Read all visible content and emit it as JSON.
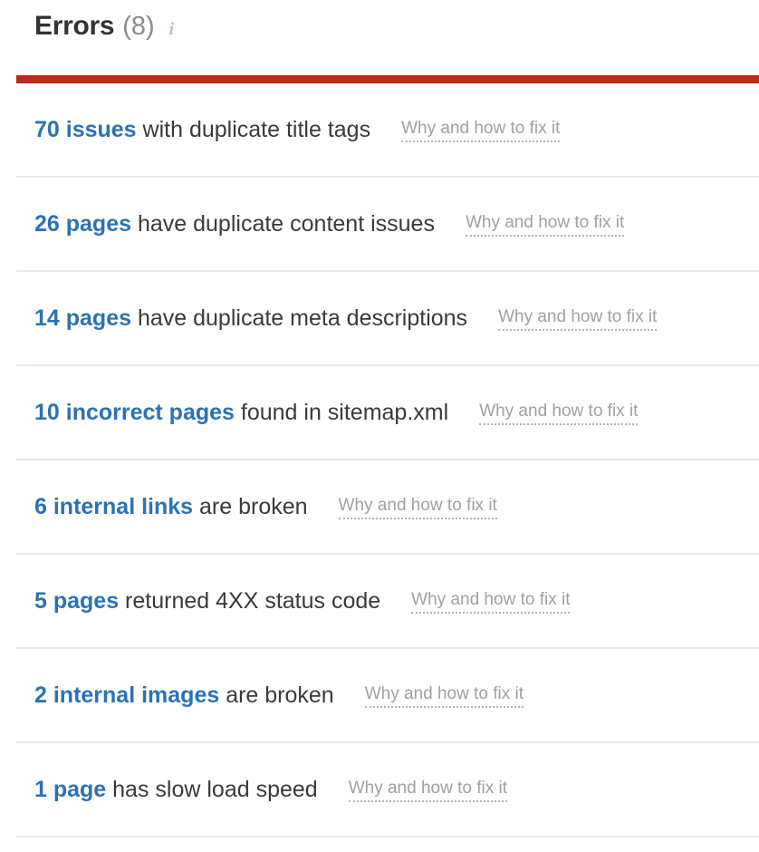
{
  "header": {
    "title": "Errors",
    "count": "(8)",
    "info_icon": "info-icon",
    "accent_color": "#bf2a1c",
    "title_color": "#333333",
    "count_color": "#8c8c8c"
  },
  "colors": {
    "severity_bar": "#bf2a1c",
    "link_blue": "#2b72b4",
    "fix_link_gray": "#a0a0a0",
    "separator": "#e4e9ef",
    "body_text": "#3a3a3a"
  },
  "issues": [
    {
      "count": "70 issues",
      "description": " with duplicate title tags",
      "fix_link": "Why and how to fix it"
    },
    {
      "count": "26 pages",
      "description": " have duplicate content issues",
      "fix_link": "Why and how to fix it"
    },
    {
      "count": "14 pages",
      "description": " have duplicate meta descriptions",
      "fix_link": "Why and how to fix it"
    },
    {
      "count": "10 incorrect pages",
      "description": " found in sitemap.xml",
      "fix_link": "Why and how to fix it"
    },
    {
      "count": "6 internal links",
      "description": " are broken",
      "fix_link": "Why and how to fix it"
    },
    {
      "count": "5 pages",
      "description": " returned 4XX status code",
      "fix_link": "Why and how to fix it"
    },
    {
      "count": "2 internal images",
      "description": " are broken",
      "fix_link": "Why and how to fix it"
    },
    {
      "count": "1 page",
      "description": " has slow load speed",
      "fix_link": "Why and how to fix it"
    }
  ]
}
